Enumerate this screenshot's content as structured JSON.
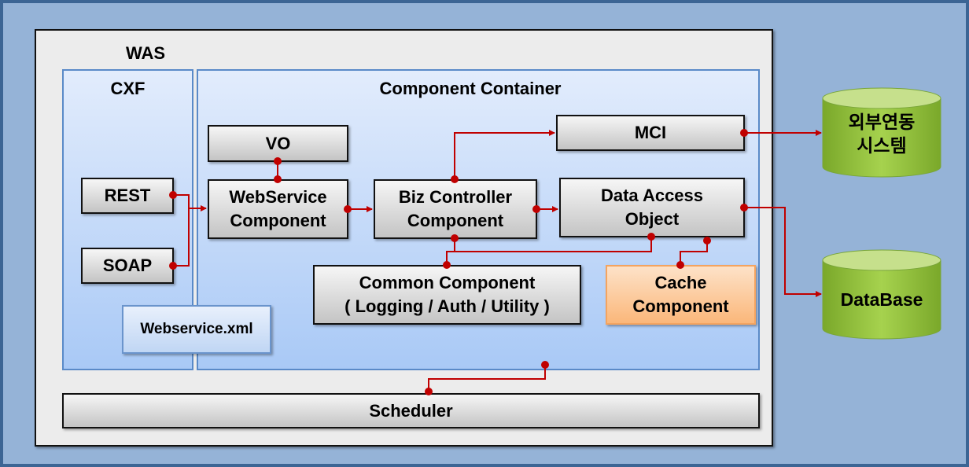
{
  "was": {
    "label": "WAS"
  },
  "cxf": {
    "label": "CXF",
    "rest": "REST",
    "soap": "SOAP"
  },
  "container": {
    "label": "Component Container"
  },
  "vo": "VO",
  "webservice_component": [
    "WebService",
    "Component"
  ],
  "biz_controller": [
    "Biz Controller",
    "Component"
  ],
  "mci": "MCI",
  "dao": [
    "Data Access",
    "Object"
  ],
  "common": [
    "Common Component",
    "( Logging / Auth / Utility )"
  ],
  "cache": [
    "Cache",
    "Component"
  ],
  "webservice_xml": "Webservice.xml",
  "scheduler": "Scheduler",
  "external": [
    "외부연동",
    "시스템"
  ],
  "database": "DataBase",
  "colors": {
    "background": "#95b3d7",
    "connector": "#c00000",
    "database": "#8fbe3c",
    "cache": "#fbb77a"
  }
}
